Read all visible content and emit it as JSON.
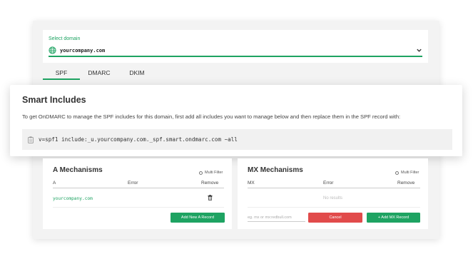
{
  "domain_select": {
    "label": "Select domain",
    "value": "yourcompany.com"
  },
  "tabs": [
    {
      "label": "SPF",
      "active": true
    },
    {
      "label": "DMARC",
      "active": false
    },
    {
      "label": "DKIM",
      "active": false
    }
  ],
  "smart_includes": {
    "title": "Smart Includes",
    "description": "To get OnDMARC to manage the SPF includes for this domain, first add all includes you want to manage below and then replace them in the SPF record with:",
    "spf_record": "v=spf1 include:_u.yourcompany.com._spf.smart.ondmarc.com ~all"
  },
  "a_mechanisms": {
    "title": "A Mechanisms",
    "multi_filter_label": "Multi Filter",
    "columns": [
      "A",
      "Error",
      "Remove"
    ],
    "rows": [
      {
        "a": "yourcompany.com",
        "error": ""
      }
    ],
    "add_button": "Add New A Record"
  },
  "mx_mechanisms": {
    "title": "MX Mechanisms",
    "multi_filter_label": "Multi Filter",
    "columns": [
      "MX",
      "Error",
      "Remove"
    ],
    "empty_text": "No results",
    "input_placeholder": "eg. mx or mx:redbull.com",
    "cancel_button": "Cancel",
    "add_button": "+ Add MX Record"
  },
  "colors": {
    "accent": "#1ea362",
    "danger": "#e14b4b"
  }
}
